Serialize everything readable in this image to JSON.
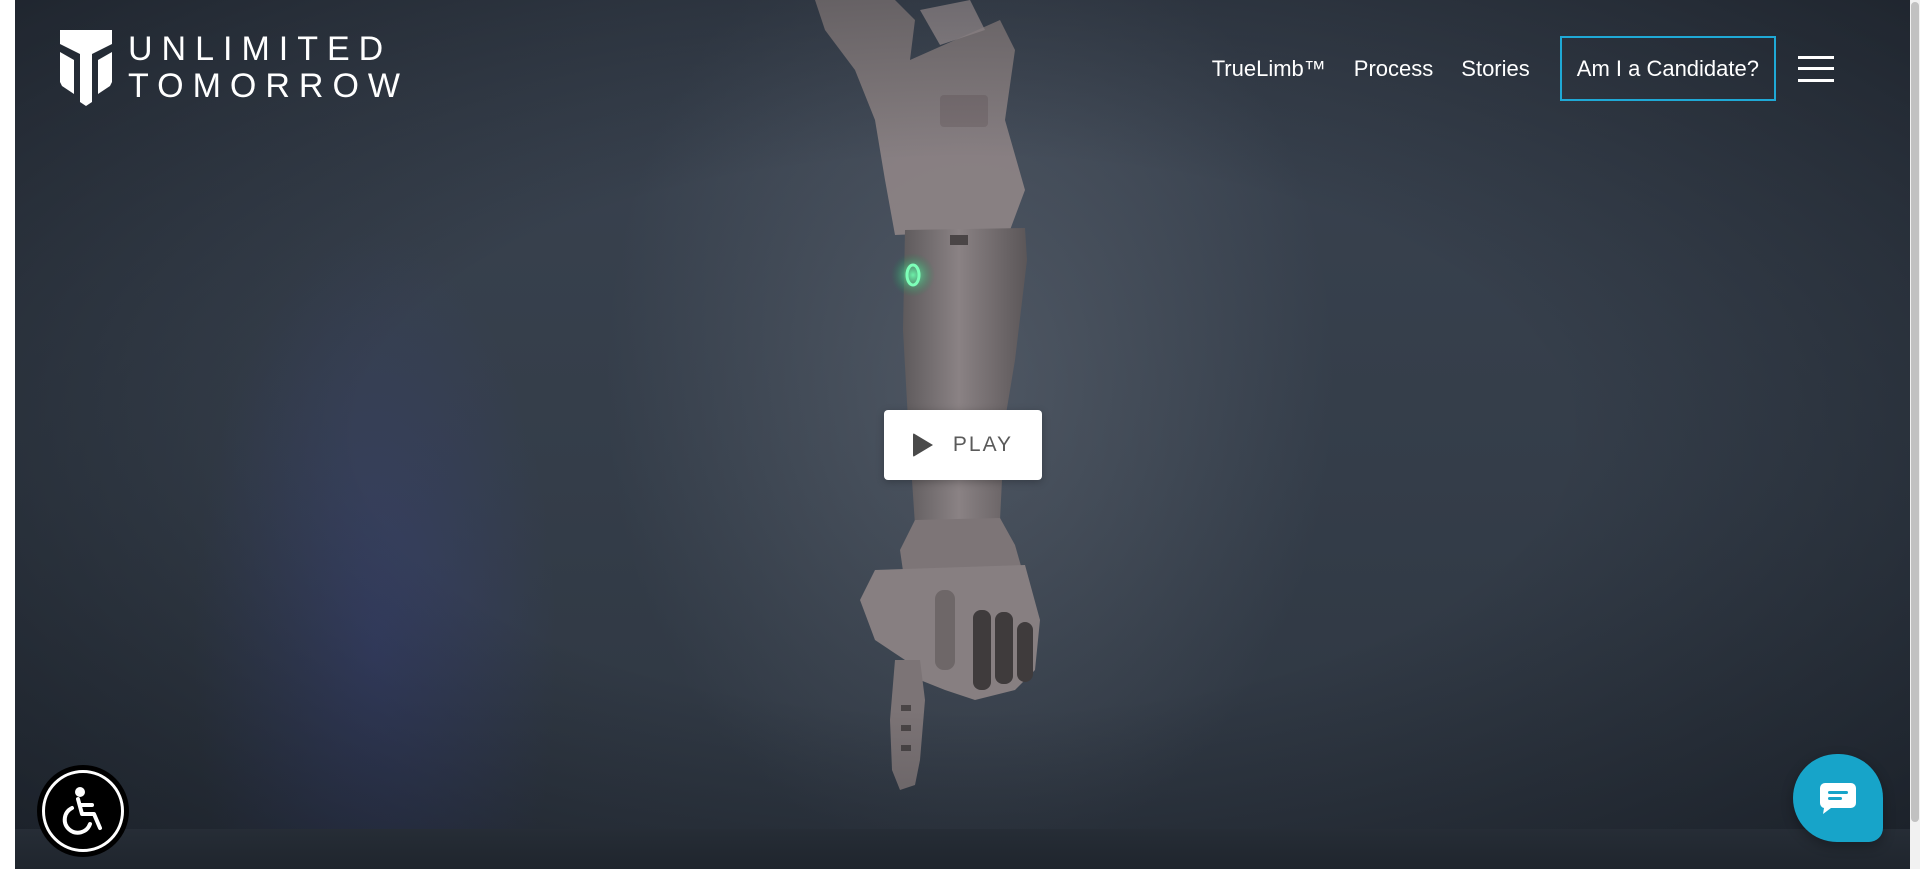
{
  "brand": {
    "line1": "UNLIMITED",
    "line2": "TOMORROW",
    "icon": "shield-logo-icon"
  },
  "nav": {
    "links": [
      {
        "label": "TrueLimb™"
      },
      {
        "label": "Process"
      },
      {
        "label": "Stories"
      }
    ],
    "cta_label": "Am I a Candidate?",
    "menu_icon": "hamburger-menu-icon"
  },
  "hero": {
    "play_label": "PLAY",
    "play_icon": "play-icon"
  },
  "widgets": {
    "accessibility_icon": "accessibility-wheelchair-icon",
    "chat_icon": "chat-bubble-icon"
  },
  "colors": {
    "accent": "#1fa9d6",
    "chat_bg": "#17a4c9",
    "hero_bg": "#343d49"
  }
}
